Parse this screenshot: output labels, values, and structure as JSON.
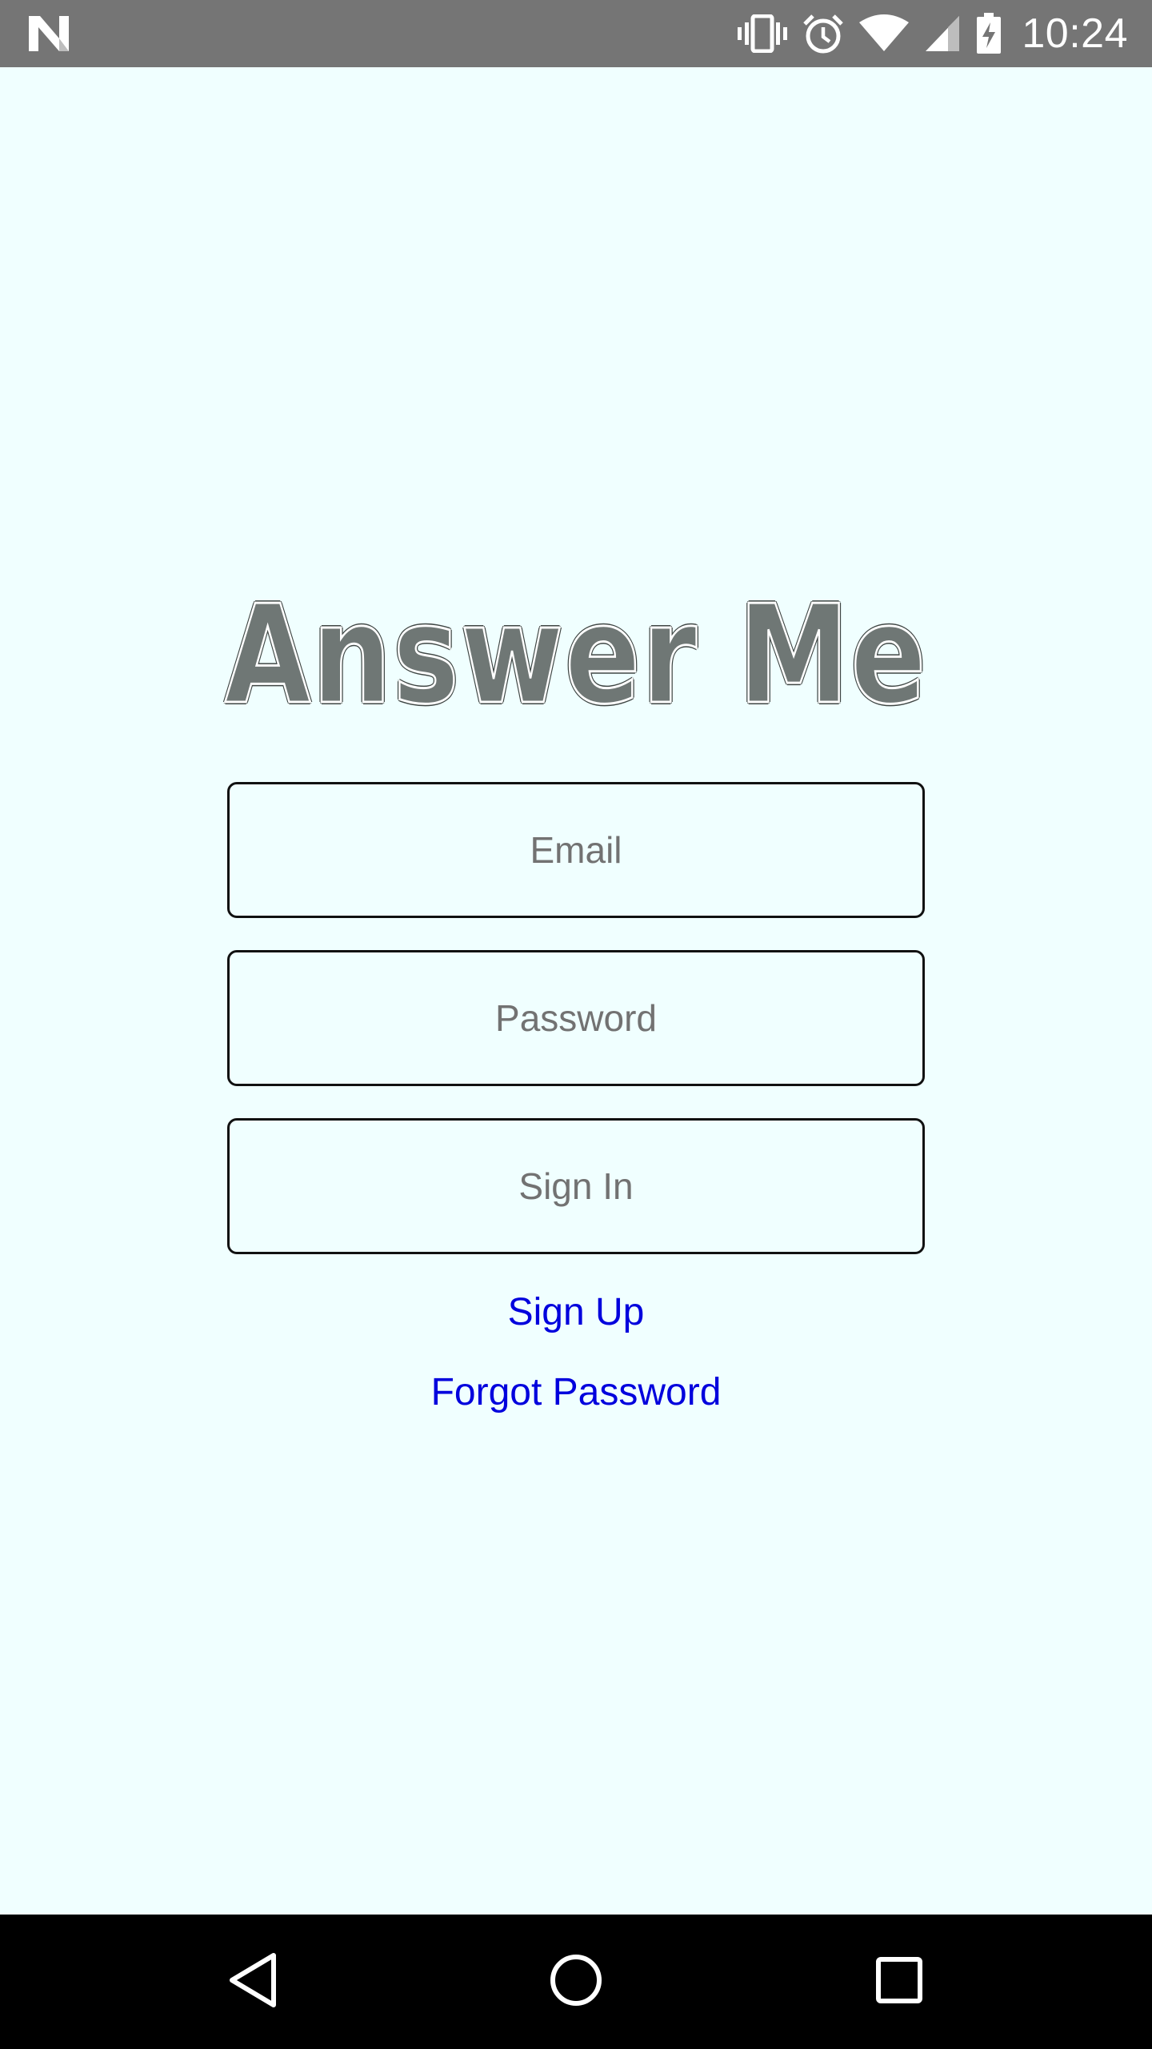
{
  "status_bar": {
    "time": "10:24",
    "icons": [
      "n-logo-icon",
      "vibrate-icon",
      "alarm-icon",
      "wifi-icon",
      "signal-icon",
      "battery-charging-icon"
    ]
  },
  "app": {
    "title": "Answer Me"
  },
  "form": {
    "email_placeholder": "Email",
    "password_placeholder": "Password",
    "sign_in_label": "Sign In",
    "sign_up_label": "Sign Up",
    "forgot_password_label": "Forgot Password"
  },
  "nav_bar": {
    "icons": [
      "back-icon",
      "home-icon",
      "recents-icon"
    ]
  },
  "colors": {
    "background": "#F0FFFF",
    "status_bar": "#757575",
    "link": "#0000DD",
    "title_fill": "#6F7775"
  }
}
